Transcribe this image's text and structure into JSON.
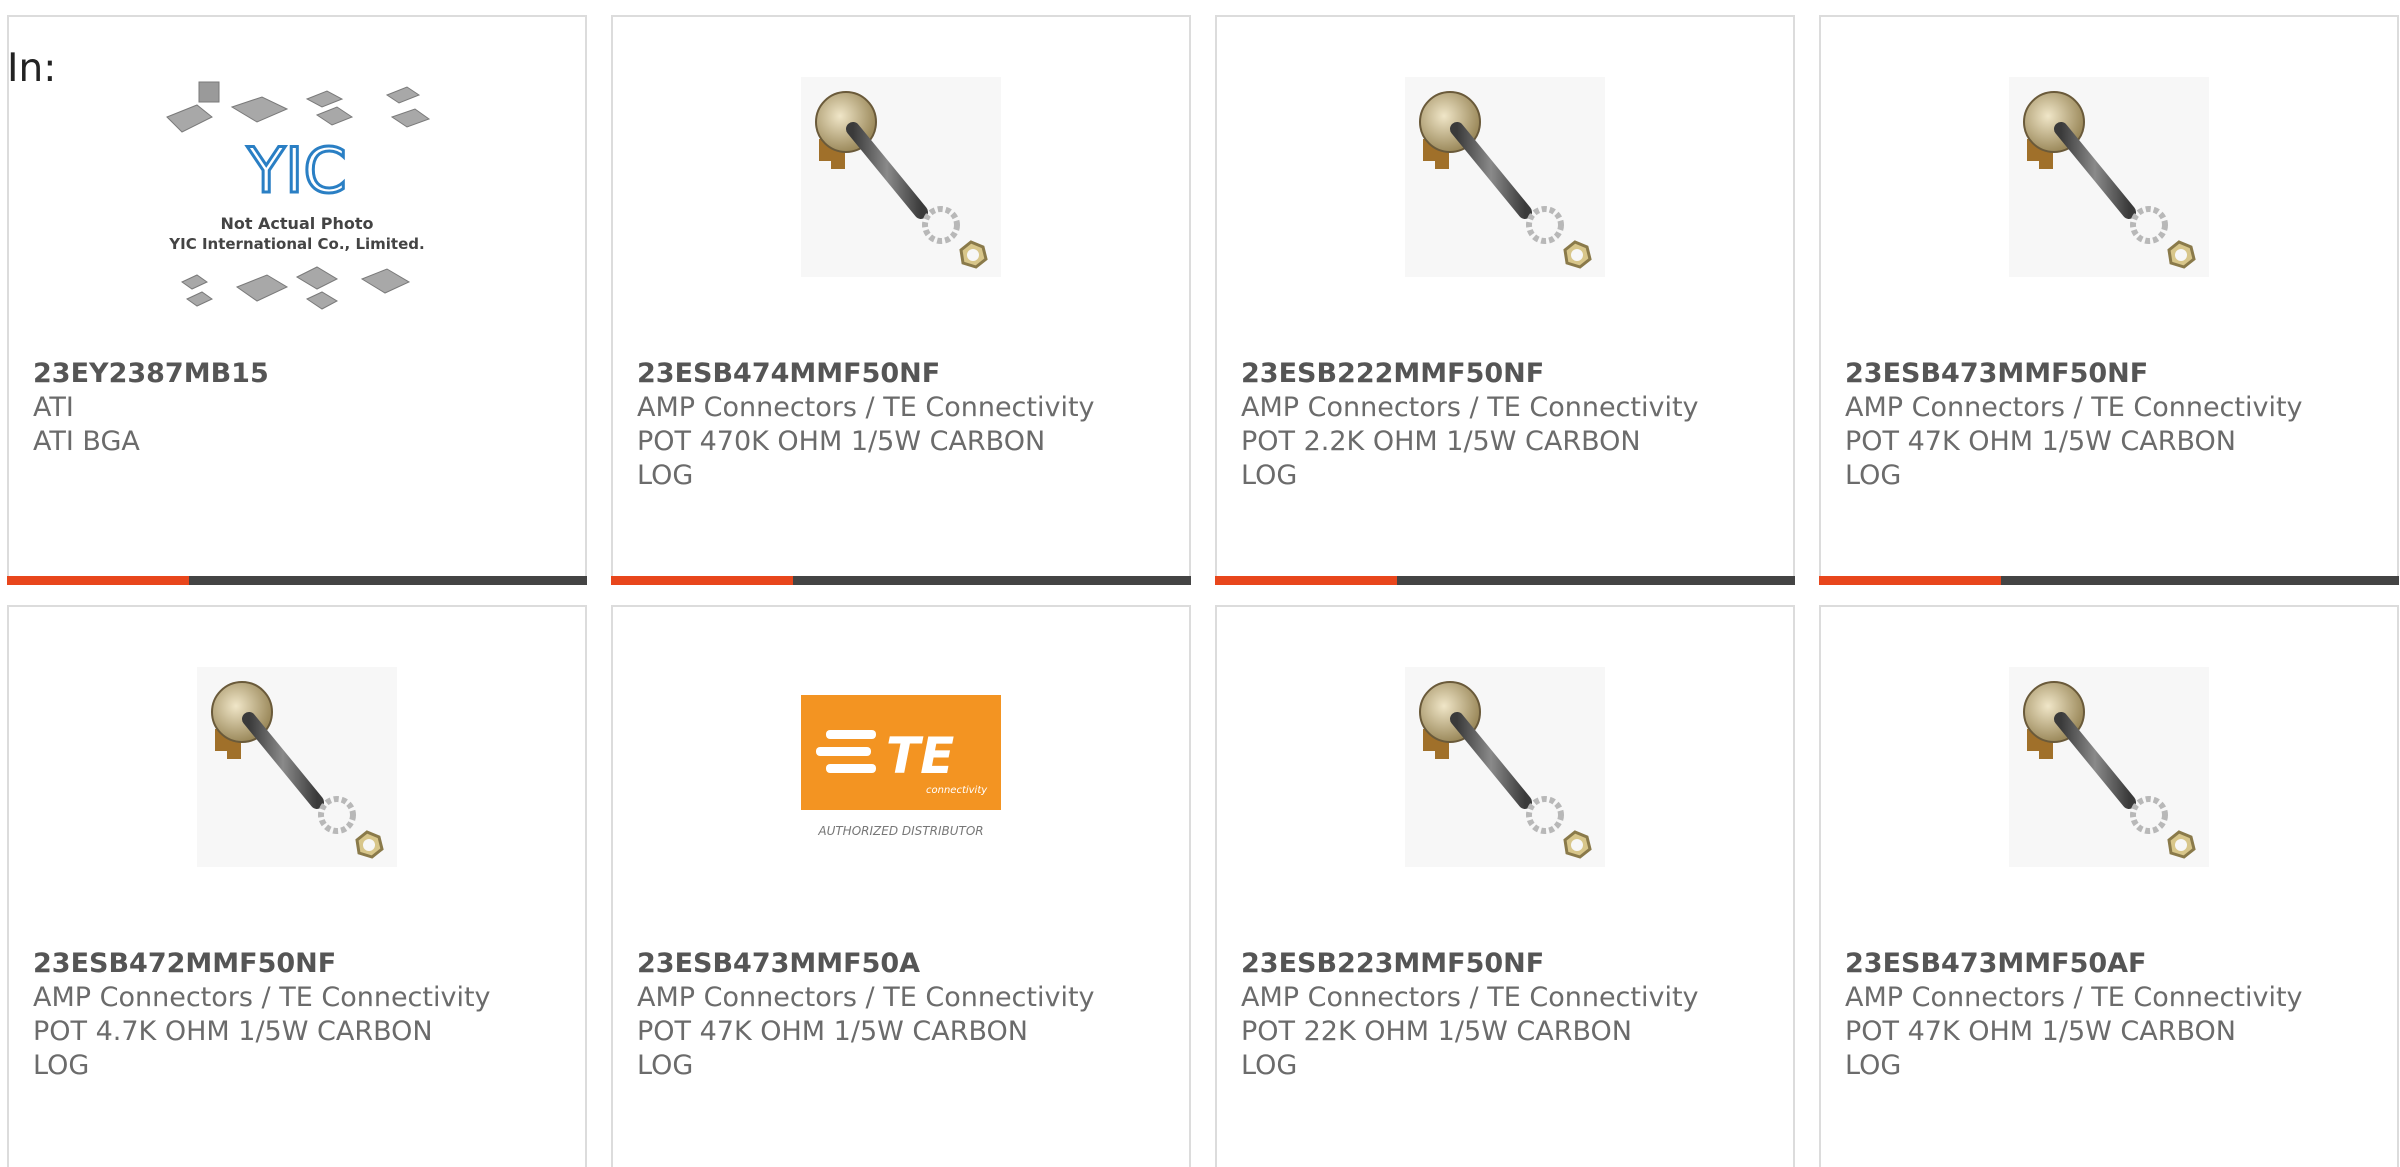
{
  "header": {
    "in_label": "In:"
  },
  "colors": {
    "accent": "#e8461c",
    "bar": "#444444",
    "border": "#dcdcdc",
    "te_orange": "#f39422"
  },
  "products": [
    {
      "part_number": "23EY2387MB15",
      "manufacturer": "ATI",
      "description": "ATI BGA",
      "image": "yic-placeholder-image",
      "image_text": {
        "logo": "YIC",
        "line1": "Not Actual Photo",
        "line2": "YIC International Co., Limited."
      }
    },
    {
      "part_number": "23ESB474MMF50NF",
      "manufacturer": "AMP Connectors / TE Connectivity",
      "description": "POT 470K OHM 1/5W CARBON LOG",
      "image": "potentiometer-image"
    },
    {
      "part_number": "23ESB222MMF50NF",
      "manufacturer": "AMP Connectors / TE Connectivity",
      "description": "POT 2.2K OHM 1/5W CARBON LOG",
      "image": "potentiometer-image"
    },
    {
      "part_number": "23ESB473MMF50NF",
      "manufacturer": "AMP Connectors / TE Connectivity",
      "description": "POT 47K OHM 1/5W CARBON LOG",
      "image": "potentiometer-image"
    },
    {
      "part_number": "23ESB472MMF50NF",
      "manufacturer": "AMP Connectors / TE Connectivity",
      "description": "POT 4.7K OHM 1/5W CARBON LOG",
      "image": "potentiometer-image"
    },
    {
      "part_number": "23ESB473MMF50A",
      "manufacturer": "AMP Connectors / TE Connectivity",
      "description": "POT 47K OHM 1/5W CARBON LOG",
      "image": "te-logo-image",
      "image_text": {
        "logo": "TE",
        "sub": "connectivity",
        "caption": "AUTHORIZED DISTRIBUTOR"
      }
    },
    {
      "part_number": "23ESB223MMF50NF",
      "manufacturer": "AMP Connectors / TE Connectivity",
      "description": "POT 22K OHM 1/5W CARBON LOG",
      "image": "potentiometer-image"
    },
    {
      "part_number": "23ESB473MMF50AF",
      "manufacturer": "AMP Connectors / TE Connectivity",
      "description": "POT 47K OHM 1/5W CARBON LOG",
      "image": "potentiometer-image"
    }
  ]
}
